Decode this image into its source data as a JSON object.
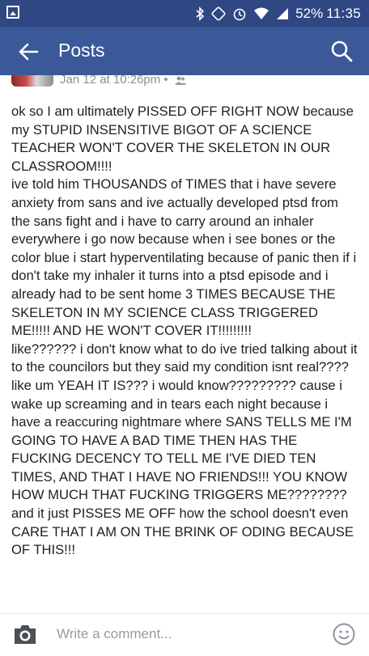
{
  "status_bar": {
    "battery": "52%",
    "time": "11:35",
    "icons": [
      "screenshot-icon",
      "bluetooth-icon",
      "nfc-icon",
      "alarm-icon",
      "wifi-icon",
      "signal-icon"
    ]
  },
  "app_bar": {
    "title": "Posts",
    "back_icon": "back-arrow-icon",
    "search_icon": "search-icon"
  },
  "post": {
    "timestamp": "Jan 12 at 10:26pm •",
    "privacy_icon": "friends-icon",
    "body": "ok so I am ultimately PISSED OFF RIGHT NOW because my STUPID INSENSITIVE BIGOT OF A SCIENCE TEACHER WON'T COVER THE SKELETON IN OUR CLASSROOM!!!!\nive told him THOUSANDS of TIMES that i have severe anxiety from sans and ive actually developed ptsd from the sans fight and i have to carry around an inhaler everywhere i go now because when i see bones or the color blue i start hyperventilating because of panic then if i don't take my inhaler it turns into a ptsd episode and i already had to be sent home 3 TIMES BECAUSE THE SKELETON IN MY SCIENCE CLASS TRIGGERED ME!!!!! AND HE WON'T COVER IT!!!!!!!!!\nlike?????? i don't know what to do ive tried talking about it to the councilors but they said my condition isnt real???? like um YEAH IT IS??? i would know????????? cause i wake up screaming and in tears each night because i have a reaccuring nightmare where SANS TELLS ME I'M GOING TO HAVE A BAD TIME THEN HAS THE FUCKING DECENCY TO TELL ME I'VE DIED TEN TIMES, AND THAT I HAVE NO FRIENDS!!! YOU KNOW HOW MUCH THAT FUCKING TRIGGERS ME????????\nand it just PISSES ME OFF how the school doesn't even CARE THAT I AM ON THE BRINK OF ODING BECAUSE OF THIS!!!"
  },
  "comment_bar": {
    "placeholder": "Write a comment...",
    "camera_icon": "camera-icon",
    "emoji_icon": "emoji-icon"
  },
  "colors": {
    "status_bar": "#2f4783",
    "app_bar": "#3b5998",
    "text": "#1f1f1f",
    "meta_text": "#8f8f8f"
  }
}
